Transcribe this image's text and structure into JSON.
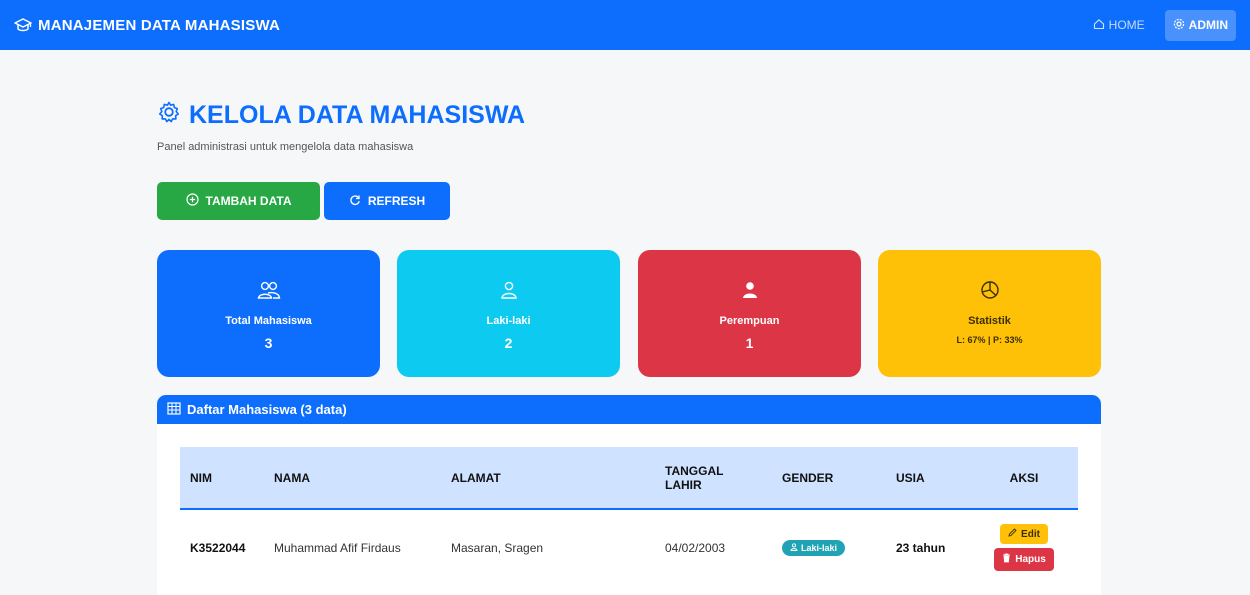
{
  "navbar": {
    "brand": "MANAJEMEN DATA MAHASISWA",
    "brand_icon": "graduation-cap-icon",
    "home_label": "HOME",
    "admin_label": "ADMIN"
  },
  "page": {
    "title": "KELOLA DATA MAHASISWA",
    "subtitle": "Panel administrasi untuk mengelola data mahasiswa"
  },
  "actions": {
    "add_label": "TAMBAH DATA",
    "refresh_label": "REFRESH"
  },
  "stats": {
    "total": {
      "label": "Total Mahasiswa",
      "value": "3",
      "icon": "people-icon"
    },
    "male": {
      "label": "Laki-laki",
      "value": "2",
      "icon": "person-icon"
    },
    "female": {
      "label": "Perempuan",
      "value": "1",
      "icon": "person-fill-icon"
    },
    "stat": {
      "label": "Statistik",
      "value": "L: 67% | P: 33%",
      "icon": "pie-chart-icon"
    }
  },
  "list": {
    "title": "Daftar Mahasiswa (3 data)",
    "columns": {
      "nim": "NIM",
      "nama": "NAMA",
      "alamat": "ALAMAT",
      "tanggal_line1": "TANGGAL",
      "tanggal_line2": "LAHIR",
      "gender": "GENDER",
      "usia": "USIA",
      "aksi": "AKSI"
    },
    "rows": [
      {
        "nim": "K3522044",
        "nama": "Muhammad Afif Firdaus",
        "alamat": "Masaran, Sragen",
        "tanggal_lahir": "04/02/2003",
        "gender": "Laki-laki",
        "usia": "23 tahun",
        "edit_label": "Edit",
        "delete_label": "Hapus"
      }
    ]
  },
  "colors": {
    "primary": "#0d6efd",
    "success": "#28a745",
    "info": "#0dcaf0",
    "danger": "#dc3545",
    "warning": "#ffc107"
  }
}
